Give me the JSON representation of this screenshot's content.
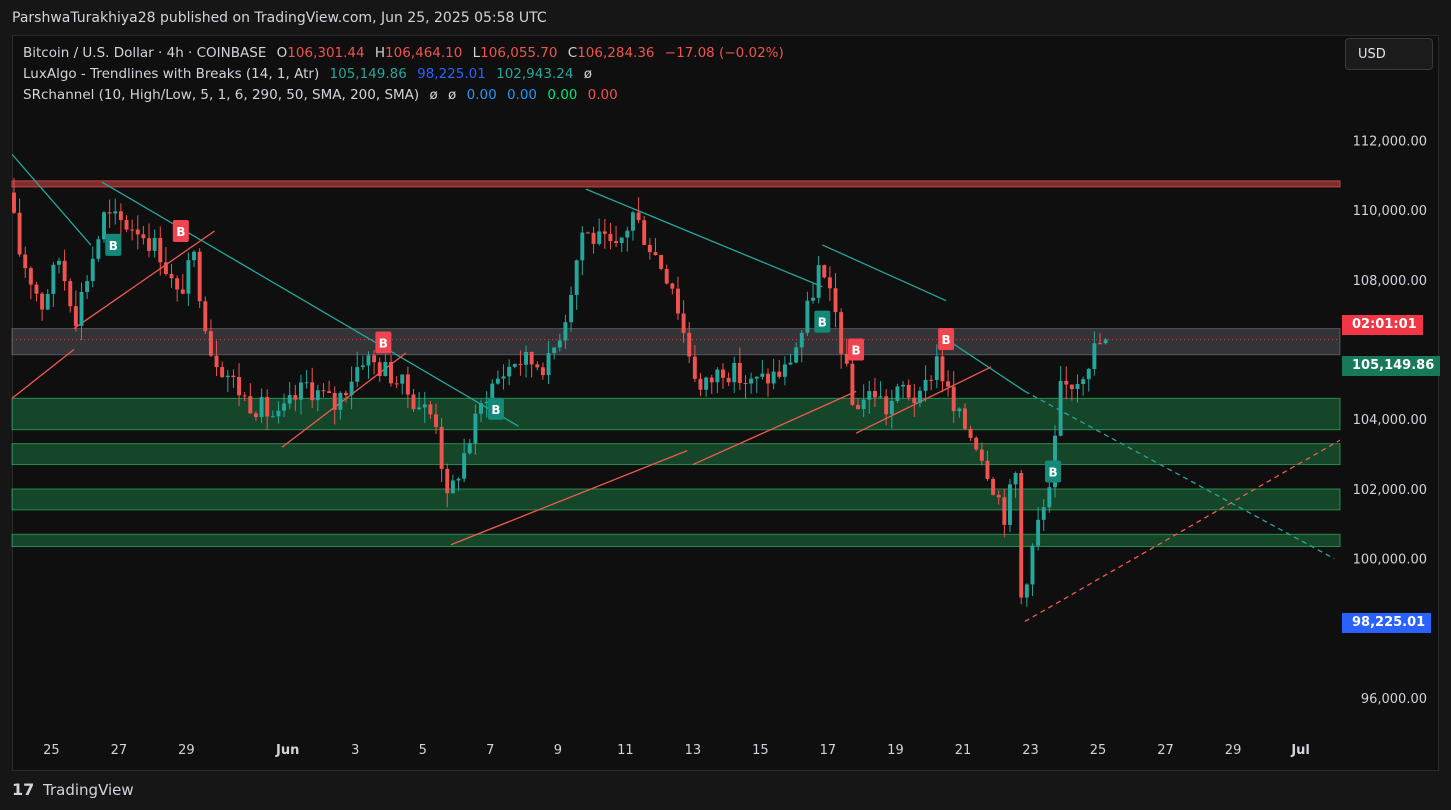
{
  "publish_line": "ParshwaTurakhiya28 published on TradingView.com, Jun 25, 2025 05:58 UTC",
  "legend": {
    "symbol": "Bitcoin / U.S. Dollar · 4h · COINBASE",
    "open_label": "O",
    "open": "106,301.44",
    "high_label": "H",
    "high": "106,464.10",
    "low_label": "L",
    "low": "106,055.70",
    "close_label": "C",
    "close": "106,284.36",
    "change": "−17.08 (−0.02%)",
    "indicator1": "LuxAlgo - Trendlines with Breaks (14, 1, Atr)",
    "indicator1_values": [
      "105,149.86",
      "98,225.01",
      "102,943.24",
      "ø"
    ],
    "indicator2": "SRchannel (10, High/Low, 5, 1, 6, 290, 50, SMA, 200, SMA)",
    "indicator2_values": [
      "ø",
      "ø",
      "0.00",
      "0.00",
      "0.00",
      "0.00"
    ]
  },
  "currency_button": "USD",
  "price_tags": {
    "countdown": "02:01:01",
    "upper_trendline": "105,149.86",
    "lower_trendline": "98,225.01"
  },
  "footer": {
    "logo": "17",
    "brand": "TradingView"
  },
  "colors": {
    "up": "#26a69a",
    "down": "#ef5350",
    "trend_down": "#26a69a",
    "trend_up": "#f05a50",
    "sr_zone": "#1f8a4c",
    "resistance": "#b23b3b",
    "blue_tag": "#2962ff"
  },
  "chart_data": {
    "type": "candlestick",
    "symbol": "BTCUSD",
    "interval": "4h",
    "ylim": [
      94800,
      113300
    ],
    "xlim": [
      "2025-05-23T20:00",
      "2025-07-02T04:00"
    ],
    "y_ticks": [
      "112,000.00",
      "110,000.00",
      "108,000.00",
      "104,000.00",
      "102,000.00",
      "100,000.00",
      "96,000.00"
    ],
    "x_ticks": [
      {
        "label": "25",
        "date": "2025-05-25"
      },
      {
        "label": "27",
        "date": "2025-05-27"
      },
      {
        "label": "29",
        "date": "2025-05-29"
      },
      {
        "label": "Jun",
        "date": "2025-06-01"
      },
      {
        "label": "3",
        "date": "2025-06-03"
      },
      {
        "label": "5",
        "date": "2025-06-05"
      },
      {
        "label": "7",
        "date": "2025-06-07"
      },
      {
        "label": "9",
        "date": "2025-06-09"
      },
      {
        "label": "11",
        "date": "2025-06-11"
      },
      {
        "label": "13",
        "date": "2025-06-13"
      },
      {
        "label": "15",
        "date": "2025-06-15"
      },
      {
        "label": "17",
        "date": "2025-06-17"
      },
      {
        "label": "19",
        "date": "2025-06-19"
      },
      {
        "label": "21",
        "date": "2025-06-21"
      },
      {
        "label": "23",
        "date": "2025-06-23"
      },
      {
        "label": "25",
        "date": "2025-06-25"
      },
      {
        "label": "27",
        "date": "2025-06-27"
      },
      {
        "label": "29",
        "date": "2025-06-29"
      },
      {
        "label": "Jul",
        "date": "2025-07-01"
      }
    ],
    "last_price": 106284.36,
    "price_path": [
      [
        "2025-05-23T20:00",
        110500
      ],
      [
        "2025-05-24T04:00",
        108800
      ],
      [
        "2025-05-24T20:00",
        107300
      ],
      [
        "2025-05-25T08:00",
        108600
      ],
      [
        "2025-05-25T20:00",
        107000
      ],
      [
        "2025-05-26T16:00",
        109800
      ],
      [
        "2025-05-27T16:00",
        109500
      ],
      [
        "2025-05-28T08:00",
        108800
      ],
      [
        "2025-05-28T20:00",
        107500
      ],
      [
        "2025-05-29T08:00",
        108600
      ],
      [
        "2025-05-29T20:00",
        106000
      ],
      [
        "2025-05-30T20:00",
        104600
      ],
      [
        "2025-05-31T20:00",
        104000
      ],
      [
        "2025-06-01T16:00",
        105000
      ],
      [
        "2025-06-02T12:00",
        104400
      ],
      [
        "2025-06-03T08:00",
        105800
      ],
      [
        "2025-06-04T04:00",
        105300
      ],
      [
        "2025-06-04T20:00",
        104600
      ],
      [
        "2025-06-05T12:00",
        104000
      ],
      [
        "2025-06-05T20:00",
        101600
      ],
      [
        "2025-06-06T08:00",
        103000
      ],
      [
        "2025-06-07T00:00",
        104800
      ],
      [
        "2025-06-07T20:00",
        105700
      ],
      [
        "2025-06-08T20:00",
        105600
      ],
      [
        "2025-06-09T08:00",
        107000
      ],
      [
        "2025-06-09T20:00",
        109400
      ],
      [
        "2025-06-10T20:00",
        108800
      ],
      [
        "2025-06-11T08:00",
        109900
      ],
      [
        "2025-06-11T20:00",
        109000
      ],
      [
        "2025-06-12T12:00",
        107900
      ],
      [
        "2025-06-12T20:00",
        106500
      ],
      [
        "2025-06-13T08:00",
        104800
      ],
      [
        "2025-06-14T00:00",
        105500
      ],
      [
        "2025-06-14T20:00",
        105000
      ],
      [
        "2025-06-15T20:00",
        105400
      ],
      [
        "2025-06-16T08:00",
        106500
      ],
      [
        "2025-06-16T20:00",
        108300
      ],
      [
        "2025-06-17T08:00",
        107000
      ],
      [
        "2025-06-17T20:00",
        104400
      ],
      [
        "2025-06-18T12:00",
        104800
      ],
      [
        "2025-06-18T20:00",
        104300
      ],
      [
        "2025-06-19T08:00",
        104900
      ],
      [
        "2025-06-19T20:00",
        104500
      ],
      [
        "2025-06-20T08:00",
        105800
      ],
      [
        "2025-06-20T20:00",
        104200
      ],
      [
        "2025-06-21T12:00",
        103400
      ],
      [
        "2025-06-21T20:00",
        102600
      ],
      [
        "2025-06-22T08:00",
        101300
      ],
      [
        "2025-06-22T16:00",
        102400
      ],
      [
        "2025-06-22T20:00",
        98900
      ],
      [
        "2025-06-23T08:00",
        101000
      ],
      [
        "2025-06-23T16:00",
        101800
      ],
      [
        "2025-06-24T00:00",
        104800
      ],
      [
        "2025-06-24T12:00",
        105200
      ],
      [
        "2025-06-25T00:00",
        106000
      ],
      [
        "2025-06-25T06:00",
        106284.36
      ]
    ],
    "support_resistance_zones": [
      {
        "from": 103700,
        "to": 104600,
        "type": "support"
      },
      {
        "from": 102700,
        "to": 103300,
        "type": "support"
      },
      {
        "from": 101400,
        "to": 102000,
        "type": "support"
      },
      {
        "from": 100350,
        "to": 100700,
        "type": "support"
      },
      {
        "from": 105850,
        "to": 106600,
        "type": "neutral"
      }
    ],
    "resistance_line": 110750,
    "trendlines": [
      {
        "color": "down",
        "dashed": false,
        "points": [
          [
            "2025-05-23T20:00",
            111600
          ],
          [
            "2025-05-26T04:00",
            109000
          ]
        ]
      },
      {
        "color": "down",
        "dashed": false,
        "points": [
          [
            "2025-05-26T12:00",
            110800
          ],
          [
            "2025-06-07T20:00",
            103800
          ]
        ]
      },
      {
        "color": "down",
        "dashed": false,
        "points": [
          [
            "2025-06-09T20:00",
            110600
          ],
          [
            "2025-06-16T20:00",
            107800
          ]
        ]
      },
      {
        "color": "down",
        "dashed": false,
        "points": [
          [
            "2025-06-16T20:00",
            109000
          ],
          [
            "2025-06-20T12:00",
            107400
          ]
        ]
      },
      {
        "color": "down",
        "dashed": false,
        "points": [
          [
            "2025-06-20T12:00",
            106300
          ],
          [
            "2025-06-22T20:00",
            104800
          ]
        ]
      },
      {
        "color": "down",
        "dashed": true,
        "points": [
          [
            "2025-06-22T20:00",
            104800
          ],
          [
            "2025-07-02T00:00",
            100000
          ]
        ]
      },
      {
        "color": "up",
        "dashed": false,
        "points": [
          [
            "2025-05-23T20:00",
            104600
          ],
          [
            "2025-05-25T16:00",
            106000
          ]
        ]
      },
      {
        "color": "up",
        "dashed": false,
        "points": [
          [
            "2025-05-25T16:00",
            106600
          ],
          [
            "2025-05-29T20:00",
            109400
          ]
        ]
      },
      {
        "color": "up",
        "dashed": false,
        "points": [
          [
            "2025-05-31T20:00",
            103200
          ],
          [
            "2025-06-04T12:00",
            105900
          ]
        ]
      },
      {
        "color": "up",
        "dashed": false,
        "points": [
          [
            "2025-06-05T20:00",
            100400
          ],
          [
            "2025-06-12T20:00",
            103100
          ]
        ]
      },
      {
        "color": "up",
        "dashed": false,
        "points": [
          [
            "2025-06-13T00:00",
            102700
          ],
          [
            "2025-06-17T20:00",
            104800
          ]
        ]
      },
      {
        "color": "up",
        "dashed": false,
        "points": [
          [
            "2025-06-17T20:00",
            103600
          ],
          [
            "2025-06-21T20:00",
            105500
          ]
        ]
      },
      {
        "color": "up",
        "dashed": true,
        "points": [
          [
            "2025-06-22T20:00",
            98200
          ],
          [
            "2025-07-02T04:00",
            103400
          ]
        ]
      }
    ],
    "break_markers": [
      {
        "label": "B",
        "type": "bullish",
        "time": "2025-05-26T20:00",
        "price": 109000
      },
      {
        "label": "B",
        "type": "bearish",
        "time": "2025-05-28T20:00",
        "price": 109400
      },
      {
        "label": "B",
        "type": "bearish",
        "time": "2025-06-03T20:00",
        "price": 106200
      },
      {
        "label": "B",
        "type": "bullish",
        "time": "2025-06-07T04:00",
        "price": 104300
      },
      {
        "label": "B",
        "type": "bullish",
        "time": "2025-06-16T20:00",
        "price": 106800
      },
      {
        "label": "B",
        "type": "bearish",
        "time": "2025-06-17T20:00",
        "price": 106000
      },
      {
        "label": "B",
        "type": "bearish",
        "time": "2025-06-20T12:00",
        "price": 106300
      },
      {
        "label": "B",
        "type": "bullish",
        "time": "2025-06-23T16:00",
        "price": 102500
      }
    ]
  }
}
